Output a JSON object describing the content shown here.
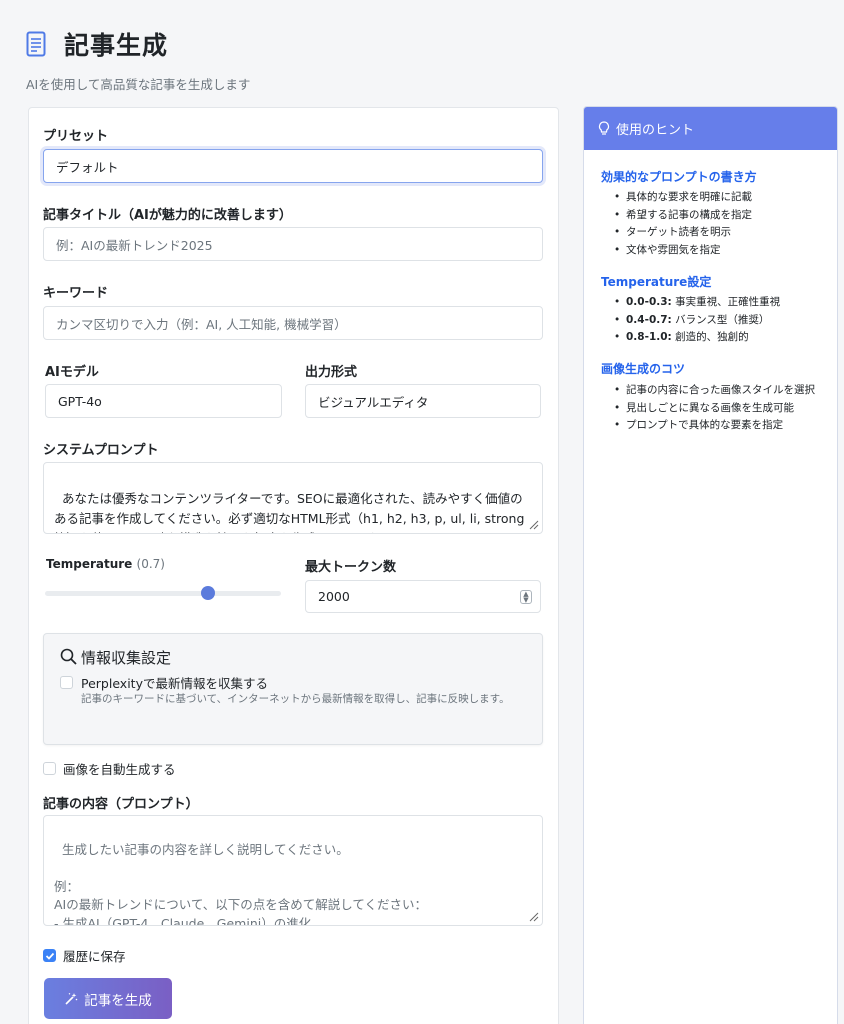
{
  "header": {
    "title": "記事生成",
    "subtitle": "AIを使用して高品質な記事を生成します"
  },
  "form": {
    "preset": {
      "label": "プリセット",
      "value": "デフォルト"
    },
    "article_title": {
      "label": "記事タイトル（AIが魅力的に改善します）",
      "placeholder": "例：AIの最新トレンド2025"
    },
    "keywords": {
      "label": "キーワード",
      "placeholder": "カンマ区切りで入力（例：AI, 人工知能, 機械学習）"
    },
    "ai_model": {
      "label": "AIモデル",
      "value": "GPT-4o"
    },
    "output_format": {
      "label": "出力形式",
      "value": "ビジュアルエディタ"
    },
    "system_prompt": {
      "label": "システムプロンプト",
      "value": "あなたは優秀なコンテンツライターです。SEOに最適化された、読みやすく価値のある記事を作成してください。必ず適切なHTML形式（h1, h2, h3, p, ul, li, strong等）を使用し、明確な構造を持った記事を生成してください。"
    },
    "temperature": {
      "label": "Temperature",
      "value_text": "(0.7)",
      "value": 0.7,
      "min": 0,
      "max": 1
    },
    "max_tokens": {
      "label": "最大トークン数",
      "value": "2000"
    },
    "research": {
      "title": "情報収集設定",
      "checkbox_label": "Perplexityで最新情報を収集する",
      "description": "記事のキーワードに基づいて、インターネットから最新情報を取得し、記事に反映します。",
      "checked": false
    },
    "auto_image": {
      "label": "画像を自動生成する",
      "checked": false
    },
    "content": {
      "label": "記事の内容（プロンプト）",
      "placeholder": "生成したい記事の内容を詳しく説明してください。\n\n例：\nAIの最新トレンドについて、以下の点を含めて解説してください：\n- 生成AI（GPT-4、Claude、Gemini）の進化\n- 画像生成技術の発展"
    },
    "save_history": {
      "label": "履歴に保存",
      "checked": true
    },
    "submit_label": "記事を生成"
  },
  "hints": {
    "header": "使用のヒント",
    "sections": [
      {
        "title": "効果的なプロンプトの書き方",
        "items": [
          "具体的な要求を明確に記載",
          "希望する記事の構成を指定",
          "ターゲット読者を明示",
          "文体や雰囲気を指定"
        ]
      },
      {
        "title": "Temperature設定",
        "items": [
          {
            "strong": "0.0-0.3:",
            "text": " 事実重視、正確性重視"
          },
          {
            "strong": "0.4-0.7:",
            "text": " バランス型（推奨）"
          },
          {
            "strong": "0.8-1.0:",
            "text": " 創造的、独創的"
          }
        ]
      },
      {
        "title": "画像生成のコツ",
        "items": [
          "記事の内容に合った画像スタイルを選択",
          "見出しごとに異なる画像を生成可能",
          "プロンプトで具体的な要素を指定"
        ]
      }
    ]
  },
  "colors": {
    "accent": "#667eea",
    "link": "#2563eb",
    "checkbox": "#3b82f6"
  }
}
